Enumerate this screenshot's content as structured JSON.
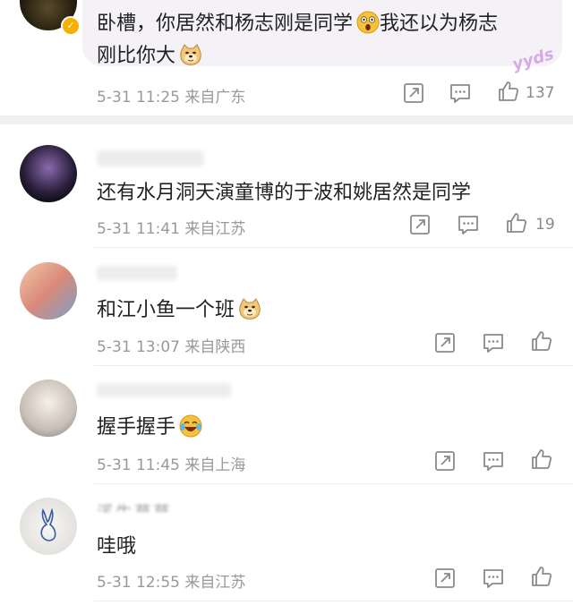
{
  "comments": [
    {
      "text": "卧槽，你居然和杨志刚是同学",
      "text2": "我还以为杨志",
      "text3": "刚比你大",
      "date": "5-31 11:25",
      "location": "来自广东",
      "likes": "137",
      "badge": "yyds"
    },
    {
      "text": "还有水月洞天演童博的于波和姚居然是同学",
      "date": "5-31 11:41",
      "location": "来自江苏",
      "likes": "19"
    },
    {
      "text": "和江小鱼一个班",
      "date": "5-31 13:07",
      "location": "来自陕西",
      "likes": ""
    },
    {
      "text": "握手握手",
      "date": "5-31 11:45",
      "location": "来自上海",
      "likes": ""
    },
    {
      "username": "溪生草草",
      "text": "哇哦",
      "date": "5-31 12:55",
      "location": "来自江苏",
      "likes": ""
    }
  ],
  "icons": [
    "share-icon",
    "comment-icon",
    "like-icon",
    "verified-badge-icon",
    "shocked-emoji-icon",
    "doge-emoji-icon",
    "laugh-cry-emoji-icon"
  ]
}
